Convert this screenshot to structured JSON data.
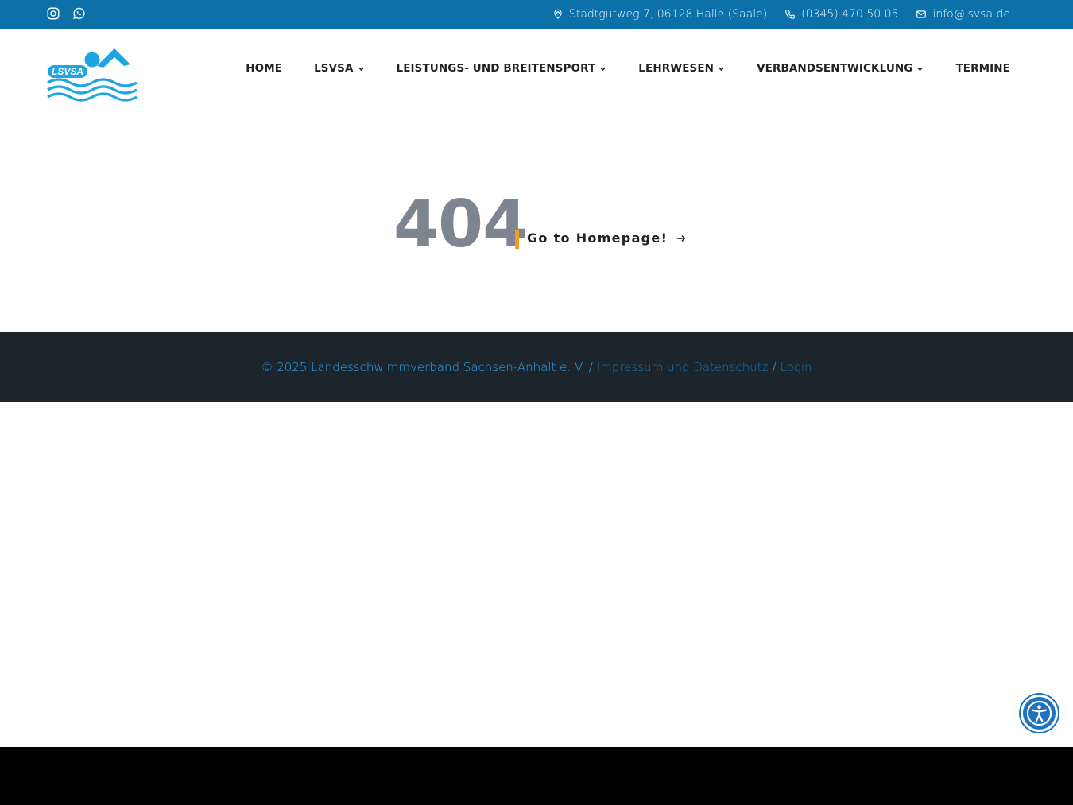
{
  "topbar": {
    "social": [
      {
        "icon": "instagram-icon"
      },
      {
        "icon": "whatsapp-icon"
      }
    ],
    "address": "Stadtgutweg 7, 06128 Halle (Saale)",
    "phone": "(0345) 470 50 05",
    "email": "info@lsvsa.de"
  },
  "logo": {
    "text": "LSVSA"
  },
  "nav": {
    "items": [
      {
        "label": "HOME",
        "dropdown": false
      },
      {
        "label": "LSVSA",
        "dropdown": true
      },
      {
        "label": "LEISTUNGS- UND BREITENSPORT",
        "dropdown": true
      },
      {
        "label": "LEHRWESEN",
        "dropdown": true
      },
      {
        "label": "VERBANDSENTWICKLUNG",
        "dropdown": true
      },
      {
        "label": "TERMINE",
        "dropdown": false
      }
    ]
  },
  "error": {
    "code": "404",
    "link_label": "Go to Homepage!"
  },
  "footer": {
    "copyright": "© 2025 Landesschwimmverband Sachsen-Anhalt e. V. /",
    "impressum": "Impressum und Datenschutz",
    "separator": "/",
    "login": "Login"
  },
  "colors": {
    "topbar": "#0b71a8",
    "accent": "#f59a23",
    "footer_bg": "#1d252c",
    "link": "#2ea3ef"
  }
}
